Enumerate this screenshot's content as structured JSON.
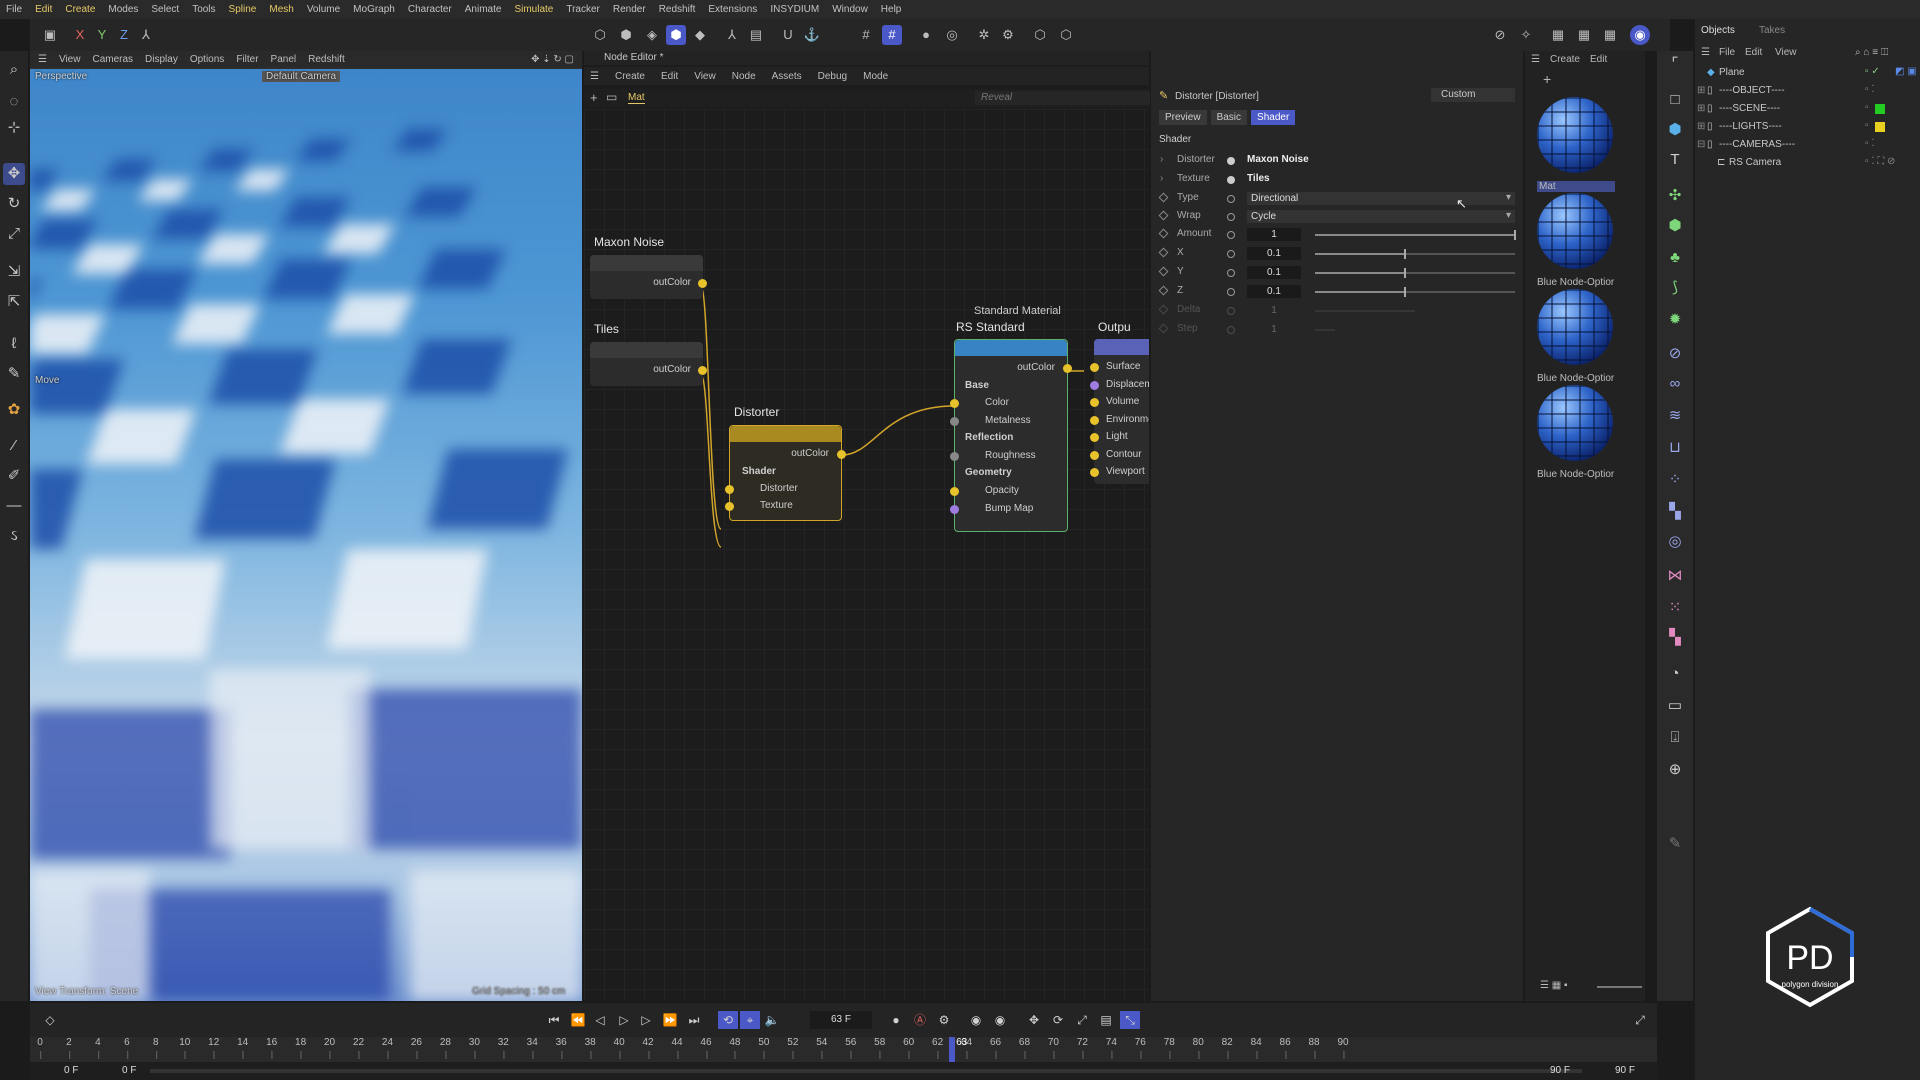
{
  "menubar": [
    "File",
    "Edit",
    "Create",
    "Modes",
    "Select",
    "Tools",
    "Spline",
    "Mesh",
    "Volume",
    "MoGraph",
    "Character",
    "Animate",
    "Simulate",
    "Tracker",
    "Render",
    "Redshift",
    "Extensions",
    "INSYDIUM",
    "Window",
    "Help"
  ],
  "toolbar": {
    "axis_x": "X",
    "axis_y": "Y",
    "axis_z": "Z"
  },
  "viewport": {
    "menu": [
      "View",
      "Cameras",
      "Display",
      "Options",
      "Filter",
      "Panel",
      "Redshift"
    ],
    "projection": "Perspective",
    "camera": "Default Camera",
    "tool_label": "Move",
    "view_transform": "View Transform: Scene",
    "grid_spacing": "Grid Spacing : 50 cm"
  },
  "node_editor": {
    "title": "Node Editor *",
    "menu": [
      "Create",
      "Edit",
      "View",
      "Node",
      "Assets",
      "Debug",
      "Mode"
    ],
    "breadcrumb": "Mat",
    "reveal_placeholder": "Reveal",
    "nodes": {
      "maxon_noise": {
        "title": "Maxon Noise",
        "out": "outColor"
      },
      "tiles": {
        "title": "Tiles",
        "out": "outColor"
      },
      "distorter": {
        "title": "Distorter",
        "out": "outColor",
        "group": "Shader",
        "inputs": [
          "Distorter",
          "Texture"
        ]
      },
      "rs_standard": {
        "subtitle": "Standard Material",
        "title": "RS Standard",
        "out": "outColor",
        "groups": [
          {
            "name": "Base",
            "inputs": [
              "Color",
              "Metalness"
            ]
          },
          {
            "name": "Reflection",
            "inputs": [
              "Roughness"
            ]
          },
          {
            "name": "Geometry",
            "inputs": [
              "Opacity",
              "Bump Map"
            ]
          }
        ]
      },
      "output": {
        "title": "Outpu",
        "inputs": [
          "Surface",
          "Displacem",
          "Volume",
          "Environme",
          "Light",
          "Contour",
          "Viewport"
        ]
      }
    }
  },
  "attributes": {
    "title": "Distorter [Distorter]",
    "preset": "Custom",
    "tabs": [
      "Preview",
      "Basic",
      "Shader"
    ],
    "active_tab": "Shader",
    "section": "Shader",
    "distorter": {
      "label": "Distorter",
      "value": "Maxon Noise"
    },
    "texture": {
      "label": "Texture",
      "value": "Tiles"
    },
    "type": {
      "label": "Type",
      "value": "Directional"
    },
    "wrap": {
      "label": "Wrap",
      "value": "Cycle"
    },
    "amount": {
      "label": "Amount",
      "value": "1",
      "level": 1.0
    },
    "x": {
      "label": "X",
      "value": "0.1",
      "level": 0.45
    },
    "y": {
      "label": "Y",
      "value": "0.1",
      "level": 0.45
    },
    "z": {
      "label": "Z",
      "value": "0.1",
      "level": 0.45
    },
    "delta": {
      "label": "Delta",
      "value": "1"
    },
    "step": {
      "label": "Step",
      "value": "1"
    }
  },
  "materials": {
    "menu": [
      "Create",
      "Edit"
    ],
    "items": [
      "Mat",
      "Blue Node-Optior",
      "Blue Node-Optior",
      "Blue Node-Optior"
    ]
  },
  "objects": {
    "tabs": [
      "Objects",
      "Takes"
    ],
    "menu": [
      "File",
      "Edit",
      "View"
    ],
    "items": [
      "Plane",
      "----OBJECT----",
      "----SCENE----",
      "----LIGHTS----",
      "----CAMERAS----",
      "RS Camera"
    ],
    "colors": {
      "scene": "#22cc22",
      "lights": "#e8d020"
    }
  },
  "timeline": {
    "current_frame": "63 F",
    "ticks": [
      "0",
      "2",
      "4",
      "6",
      "8",
      "10",
      "12",
      "14",
      "16",
      "18",
      "20",
      "22",
      "24",
      "26",
      "28",
      "30",
      "32",
      "34",
      "36",
      "38",
      "40",
      "42",
      "44",
      "46",
      "48",
      "50",
      "52",
      "54",
      "56",
      "58",
      "60",
      "62",
      "64",
      "66",
      "68",
      "70",
      "72",
      "74",
      "76",
      "78",
      "80",
      "82",
      "84",
      "86",
      "88",
      "90"
    ],
    "playhead_value": 63,
    "start": "0 F",
    "min": "0 F",
    "max": "90 F",
    "end": "90 F",
    "playhead_label": "63"
  },
  "logo": {
    "text": "polygon division",
    "mark": "PD"
  },
  "accent": "#4a58c8"
}
